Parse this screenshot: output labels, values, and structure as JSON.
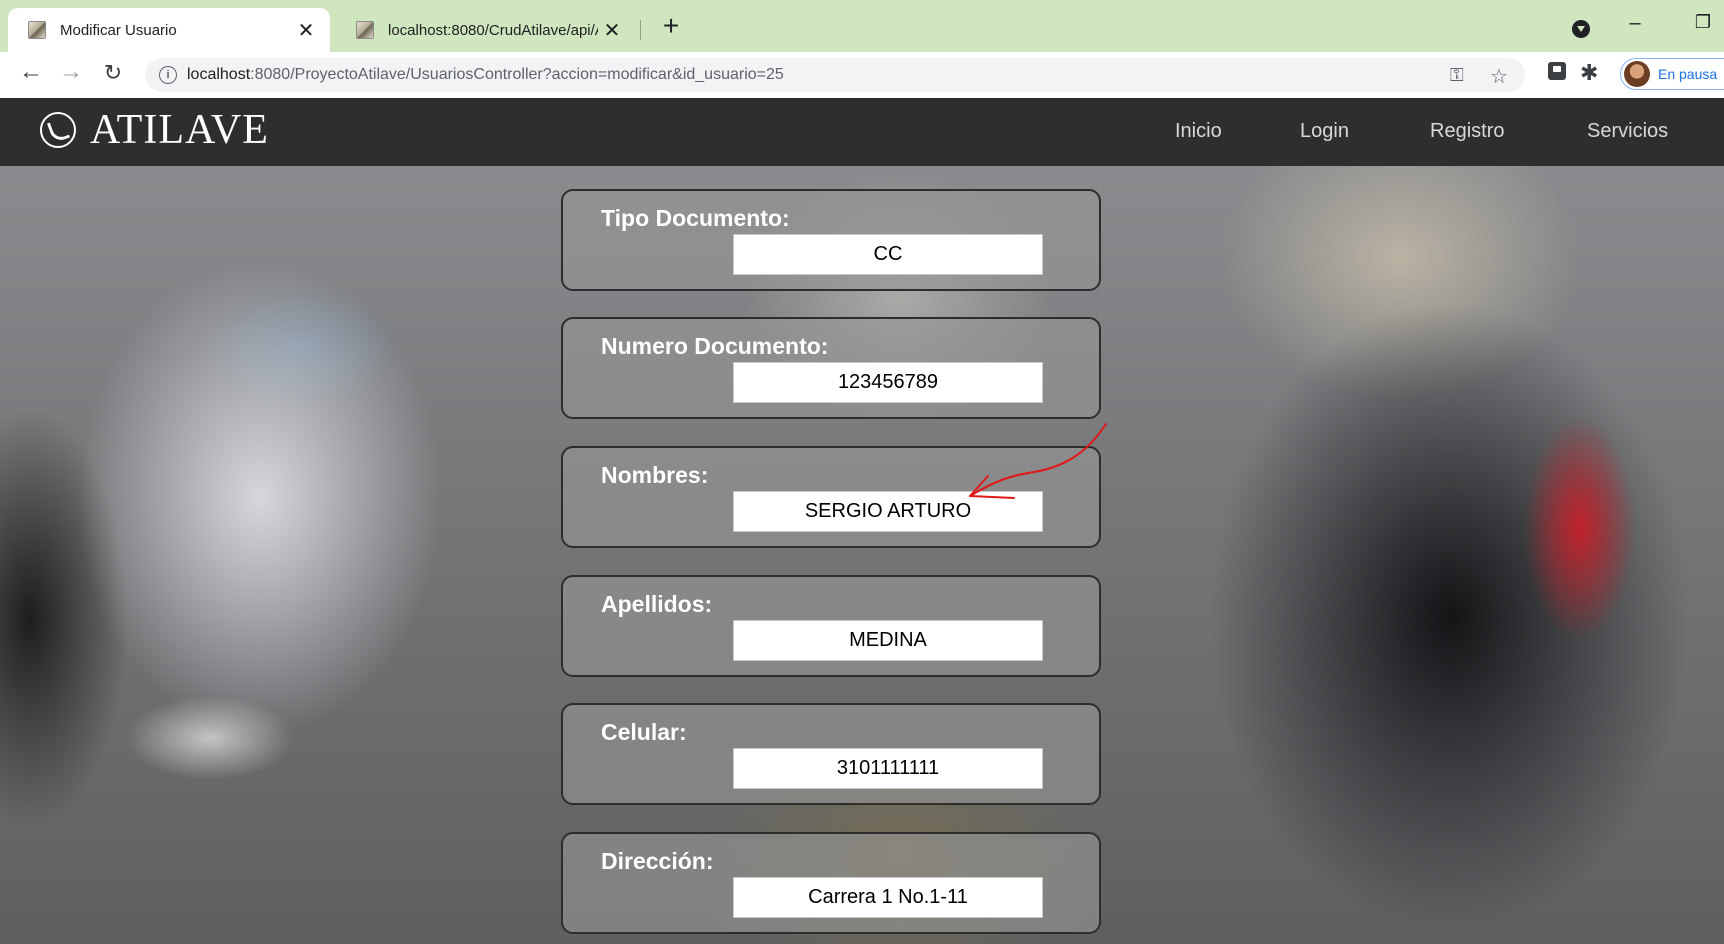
{
  "browser": {
    "tabs": [
      {
        "title": "Modificar Usuario",
        "active": true
      },
      {
        "title": "localhost:8080/CrudAtilave/api/A",
        "active": false
      }
    ],
    "url_host": "localhost",
    "url_path": ":8080/ProyectoAtilave/UsuariosController?accion=modificar&id_usuario=25",
    "profile_status": "En pausa"
  },
  "site": {
    "brand": "ATILAVE",
    "menu": [
      "Inicio",
      "Login",
      "Registro",
      "Servicios"
    ]
  },
  "form": {
    "fields": [
      {
        "label": "Tipo Documento:",
        "value": "CC"
      },
      {
        "label": "Numero Documento:",
        "value": "123456789"
      },
      {
        "label": "Nombres:",
        "value": "SERGIO ARTURO"
      },
      {
        "label": "Apellidos:",
        "value": "MEDINA"
      },
      {
        "label": "Celular:",
        "value": "3101111111"
      },
      {
        "label": "Dirección:",
        "value": "Carrera 1 No.1-11"
      }
    ]
  },
  "colors": {
    "navbar": "#2e2e2e",
    "tabbar": "#cfe6bf",
    "annotation_arrow": "#e01818"
  }
}
